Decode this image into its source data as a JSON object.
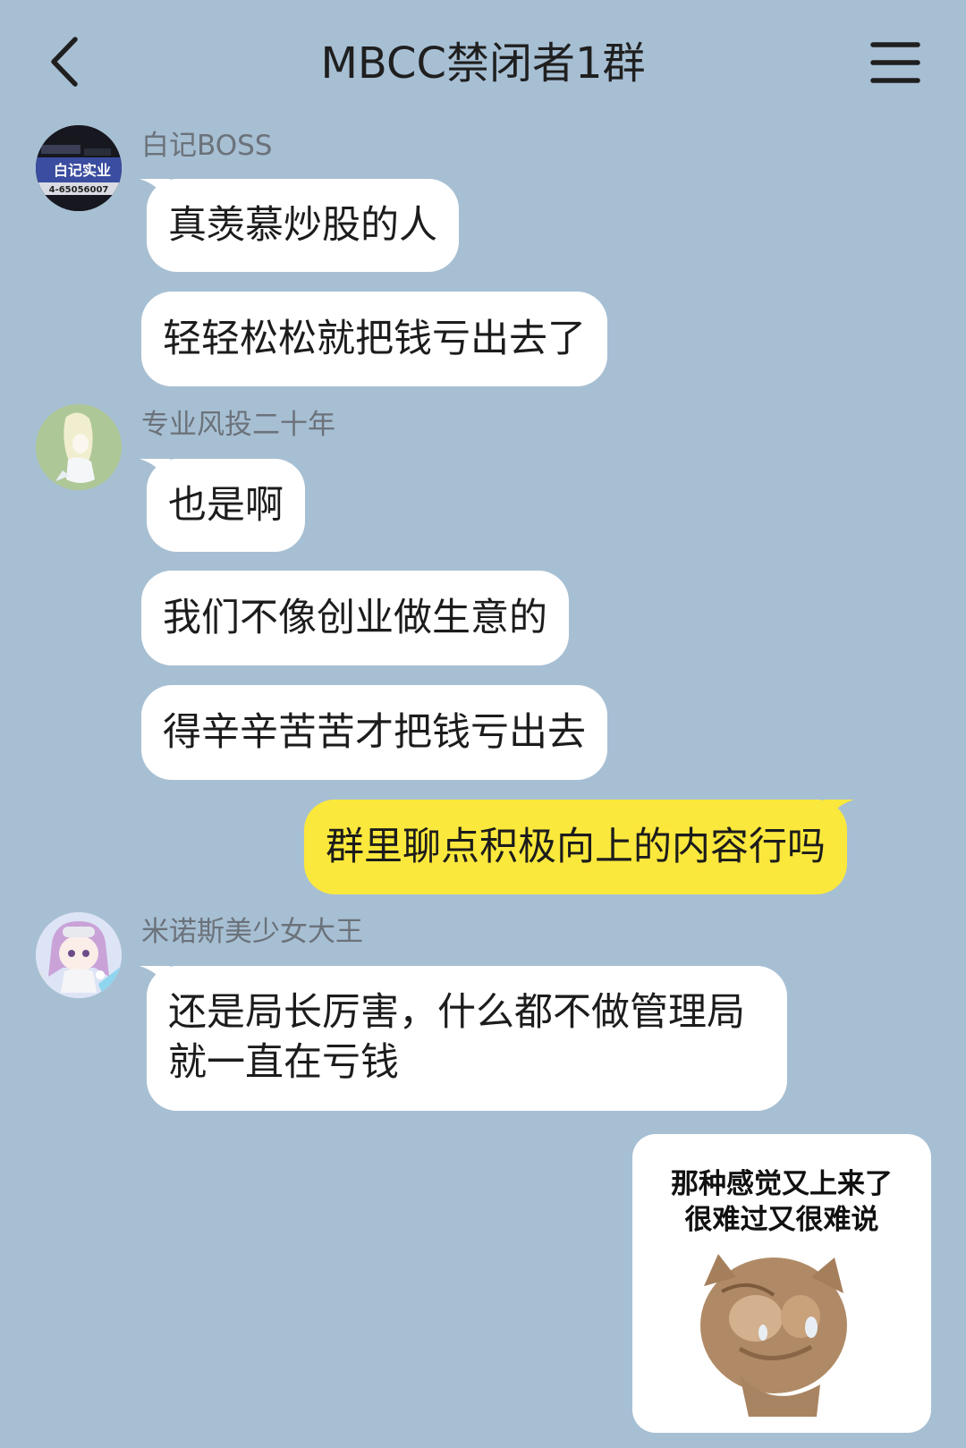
{
  "header": {
    "title": "MBCC禁闭者1群",
    "back_icon": "chevron-left-icon",
    "menu_icon": "hamburger-menu-icon"
  },
  "colors": {
    "background": "#a7bfd3",
    "incoming_bubble": "#ffffff",
    "outgoing_bubble": "#fbe83c"
  },
  "avatars": {
    "boss": {
      "line1": "白记实业",
      "line2": "4-65056007"
    }
  },
  "messages": [
    {
      "sender": "白记BOSS",
      "text": "真羡慕炒股的人"
    },
    {
      "text": "轻轻松松就把钱亏出去了"
    },
    {
      "sender": "专业风投二十年",
      "text": "也是啊"
    },
    {
      "text": "我们不像创业做生意的"
    },
    {
      "text": "得辛辛苦苦才把钱亏出去"
    },
    {
      "text": "群里聊点积极向上的内容行吗",
      "outgoing": true
    },
    {
      "sender": "米诺斯美少女大王",
      "text": "还是局长厉害，什么都不做管理局就一直在亏钱"
    },
    {
      "outgoing": true,
      "sticker": {
        "line1": "那种感觉又上来了",
        "line2": "很难过又很难说",
        "icon": "crying-cat-sticker"
      }
    }
  ]
}
